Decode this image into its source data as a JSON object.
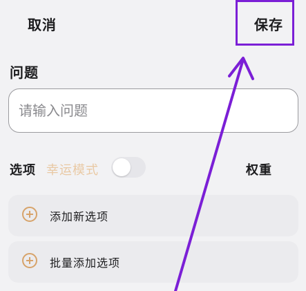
{
  "header": {
    "cancel_label": "取消",
    "save_label": "保存"
  },
  "question": {
    "section_label": "问题",
    "input_placeholder": "请输入问题",
    "input_value": ""
  },
  "options": {
    "label": "选项",
    "lucky_mode_label": "幸运模式",
    "lucky_mode_on": false,
    "weight_label": "权重"
  },
  "actions": {
    "add_option_label": "添加新选项",
    "bulk_add_label": "批量添加选项"
  },
  "colors": {
    "annotation": "#7b1fd6",
    "accent": "#d7a36a",
    "lucky_text": "#e9c9a4"
  }
}
